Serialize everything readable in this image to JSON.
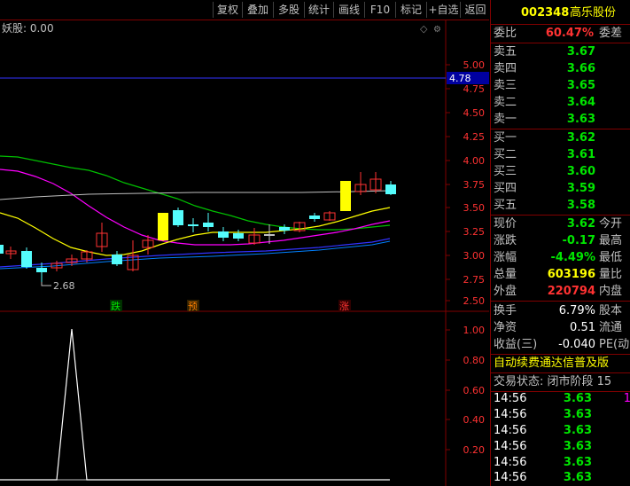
{
  "toolbar": {
    "buttons": [
      "复权",
      "叠加",
      "多股",
      "统计",
      "画线",
      "F10",
      "标记",
      "+自选",
      "返回"
    ]
  },
  "chart": {
    "title": "妖股: 0.00",
    "price_axis": [
      "5.00",
      "4.75",
      "4.50",
      "4.25",
      "4.00",
      "3.75",
      "3.50",
      "3.25",
      "3.00",
      "2.75",
      "2.50"
    ],
    "crosshair_price": "4.78",
    "low_label": "2.68",
    "signals": [
      {
        "text": "跌",
        "color": "#00e600"
      },
      {
        "text": "预",
        "color": "#ff8000"
      },
      {
        "text": "涨",
        "color": "#ff3232"
      }
    ],
    "indicator_axis": [
      "1.00",
      "0.80",
      "0.60",
      "0.40",
      "0.20"
    ]
  },
  "panel": {
    "code": "002348",
    "name": "高乐股份",
    "webi_label": "委比",
    "webi_value": "60.47%",
    "weicha_label": "委差",
    "sell": [
      {
        "label": "卖五",
        "price": "3.67"
      },
      {
        "label": "卖四",
        "price": "3.66"
      },
      {
        "label": "卖三",
        "price": "3.65"
      },
      {
        "label": "卖二",
        "price": "3.64"
      },
      {
        "label": "卖一",
        "price": "3.63"
      }
    ],
    "buy": [
      {
        "label": "买一",
        "price": "3.62"
      },
      {
        "label": "买二",
        "price": "3.61"
      },
      {
        "label": "买三",
        "price": "3.60"
      },
      {
        "label": "买四",
        "price": "3.59"
      },
      {
        "label": "买五",
        "price": "3.58"
      }
    ],
    "quotes": [
      {
        "label": "现价",
        "value": "3.62",
        "value_color": "#00e600",
        "label2": "今开"
      },
      {
        "label": "涨跌",
        "value": "-0.17",
        "value_color": "#00e600",
        "label2": "最高"
      },
      {
        "label": "涨幅",
        "value": "-4.49%",
        "value_color": "#00e600",
        "label2": "最低"
      },
      {
        "label": "总量",
        "value": "603196",
        "value_color": "#ffff00",
        "label2": "量比"
      },
      {
        "label": "外盘",
        "value": "220794",
        "value_color": "#ff3232",
        "label2": "内盘"
      }
    ],
    "finance": [
      {
        "label": "换手",
        "value": "6.79%",
        "label2": "股本"
      },
      {
        "label": "净资",
        "value": "0.51",
        "label2": "流通"
      },
      {
        "label": "收益(三)",
        "value": "-0.040",
        "label2": "PE(动"
      }
    ],
    "marquee": "自动续费通达信普及版",
    "trade_status": "交易状态: 闭市阶段 15",
    "ticks": [
      {
        "time": "14:56",
        "price": "3.63",
        "mark": "1"
      },
      {
        "time": "14:56",
        "price": "3.63",
        "mark": ""
      },
      {
        "time": "14:56",
        "price": "3.63",
        "mark": ""
      },
      {
        "time": "14:56",
        "price": "3.63",
        "mark": ""
      },
      {
        "time": "14:56",
        "price": "3.63",
        "mark": ""
      },
      {
        "time": "14:56",
        "price": "3.63",
        "mark": ""
      },
      {
        "time": "14:56",
        "price": "3.63",
        "mark": ""
      }
    ]
  }
}
